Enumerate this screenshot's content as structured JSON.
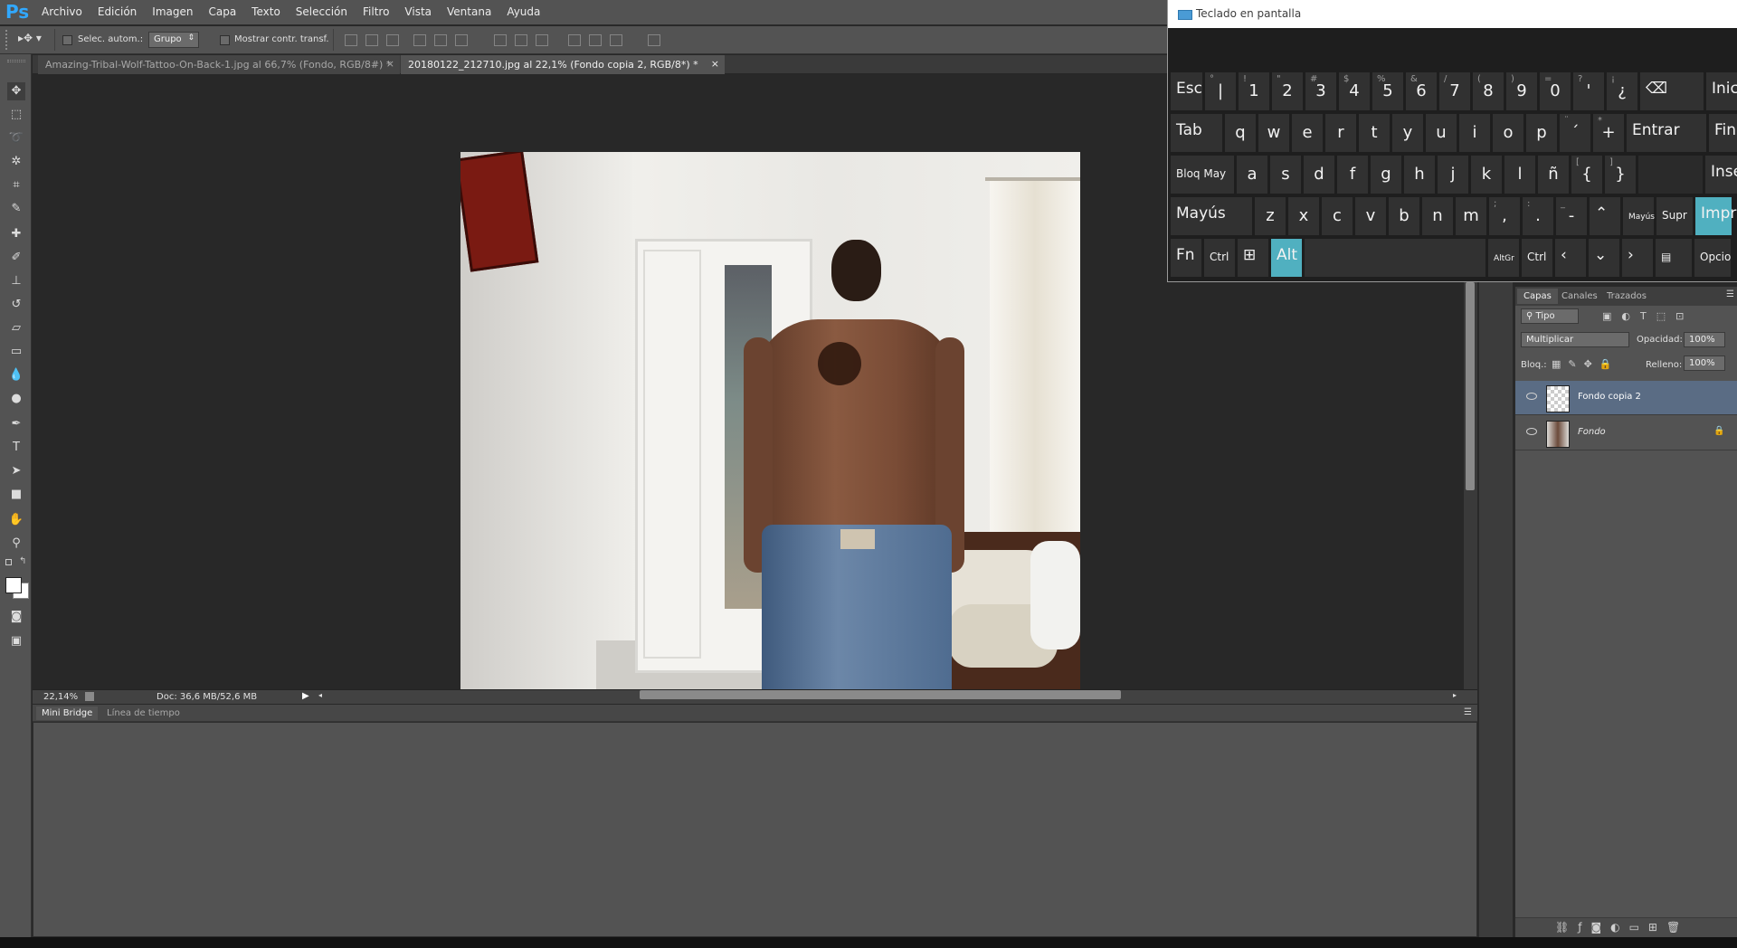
{
  "app": {
    "logo": "Ps",
    "menu": [
      "Archivo",
      "Edición",
      "Imagen",
      "Capa",
      "Texto",
      "Selección",
      "Filtro",
      "Vista",
      "Ventana",
      "Ayuda"
    ]
  },
  "options": {
    "auto_select_label": "Selec. autom.:",
    "auto_select_value": "Grupo",
    "transform_controls_label": "Mostrar contr. transf."
  },
  "tabs": [
    {
      "label": "Amazing-Tribal-Wolf-Tattoo-On-Back-1.jpg al 66,7% (Fondo, RGB/8#) *",
      "close": "×"
    },
    {
      "label": "20180122_212710.jpg al 22,1% (Fondo copia 2, RGB/8*) *",
      "close": "×"
    }
  ],
  "status": {
    "zoom": "22,14%",
    "doc": "Doc: 36,6 MB/52,6 MB"
  },
  "bottom_panel": {
    "tabs": [
      "Mini Bridge",
      "Línea de tiempo"
    ]
  },
  "layers": {
    "tabs": [
      "Capas",
      "Canales",
      "Trazados"
    ],
    "filter": "Tipo",
    "blend_mode": "Multiplicar",
    "opacity_label": "Opacidad:",
    "opacity": "100%",
    "lock_label": "Bloq.:",
    "fill_label": "Relleno:",
    "fill": "100%",
    "items": [
      {
        "name": "Fondo copia 2",
        "selected": true
      },
      {
        "name": "Fondo",
        "locked": true
      }
    ]
  },
  "osk": {
    "title": "Teclado en pantalla",
    "right_keys": [
      "Inic",
      "Fin",
      "Inser",
      "Impr",
      "Opcio"
    ],
    "active_color": "#50b0c0"
  },
  "colors": {
    "ps_blue": "#31a8ff",
    "panel": "#535353",
    "canvas_bg": "#282828"
  }
}
